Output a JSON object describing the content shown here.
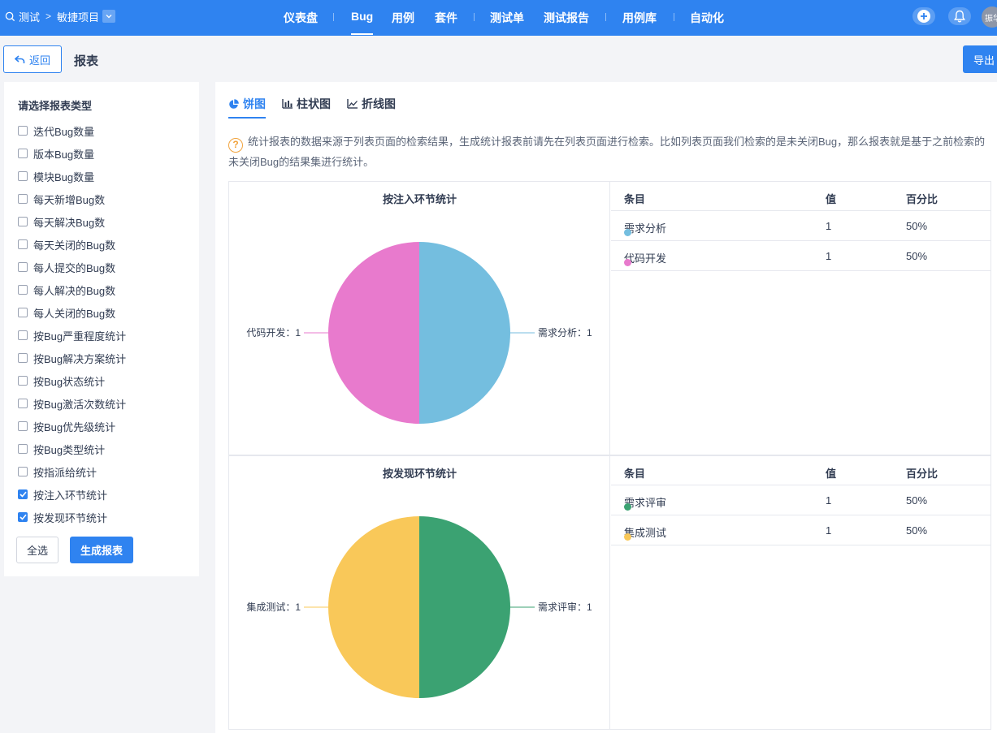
{
  "breadcrumb": {
    "product": "测试",
    "project": "敏捷项目"
  },
  "nav": {
    "tabs": [
      "仪表盘",
      "Bug",
      "用例",
      "套件",
      "测试单",
      "测试报告",
      "用例库",
      "自动化"
    ],
    "active": "Bug",
    "avatar_text": "振华"
  },
  "header": {
    "back_label": "返回",
    "title": "报表",
    "export_label": "导出"
  },
  "left": {
    "title": "请选择报表类型",
    "options": [
      {
        "label": "迭代Bug数量",
        "checked": false
      },
      {
        "label": "版本Bug数量",
        "checked": false
      },
      {
        "label": "模块Bug数量",
        "checked": false
      },
      {
        "label": "每天新增Bug数",
        "checked": false
      },
      {
        "label": "每天解决Bug数",
        "checked": false
      },
      {
        "label": "每天关闭的Bug数",
        "checked": false
      },
      {
        "label": "每人提交的Bug数",
        "checked": false
      },
      {
        "label": "每人解决的Bug数",
        "checked": false
      },
      {
        "label": "每人关闭的Bug数",
        "checked": false
      },
      {
        "label": "按Bug严重程度统计",
        "checked": false
      },
      {
        "label": "按Bug解决方案统计",
        "checked": false
      },
      {
        "label": "按Bug状态统计",
        "checked": false
      },
      {
        "label": "按Bug激活次数统计",
        "checked": false
      },
      {
        "label": "按Bug优先级统计",
        "checked": false
      },
      {
        "label": "按Bug类型统计",
        "checked": false
      },
      {
        "label": "按指派给统计",
        "checked": false
      },
      {
        "label": "按注入环节统计",
        "checked": true
      },
      {
        "label": "按发现环节统计",
        "checked": true
      }
    ],
    "select_all_label": "全选",
    "generate_label": "生成报表"
  },
  "main": {
    "chart_tabs": [
      {
        "label": "饼图",
        "icon": "pie-chart-icon"
      },
      {
        "label": "柱状图",
        "icon": "bar-chart-icon"
      },
      {
        "label": "折线图",
        "icon": "line-chart-icon"
      }
    ],
    "active_tab": "饼图",
    "tip": "统计报表的数据来源于列表页面的检索结果，生成统计报表前请先在列表页面进行检索。比如列表页面我们检索的是未关闭Bug，那么报表就是基于之前检索的未关闭Bug的结果集进行统计。",
    "table_headers": {
      "item": "条目",
      "value": "值",
      "percent": "百分比"
    }
  },
  "chart_data": [
    {
      "type": "pie",
      "title": "按注入环节统计",
      "slices": [
        {
          "name": "需求分析",
          "value": 1,
          "percent": "50%",
          "color": "#74bedf",
          "label": "需求分析：1"
        },
        {
          "name": "代码开发",
          "value": 1,
          "percent": "50%",
          "color": "#e87acd",
          "label": "代码开发：1"
        }
      ]
    },
    {
      "type": "pie",
      "title": "按发现环节统计",
      "slices": [
        {
          "name": "需求评审",
          "value": 1,
          "percent": "50%",
          "color": "#3ba272",
          "label": "需求评审：1"
        },
        {
          "name": "集成测试",
          "value": 1,
          "percent": "50%",
          "color": "#f9c859",
          "label": "集成测试：1"
        }
      ]
    }
  ]
}
